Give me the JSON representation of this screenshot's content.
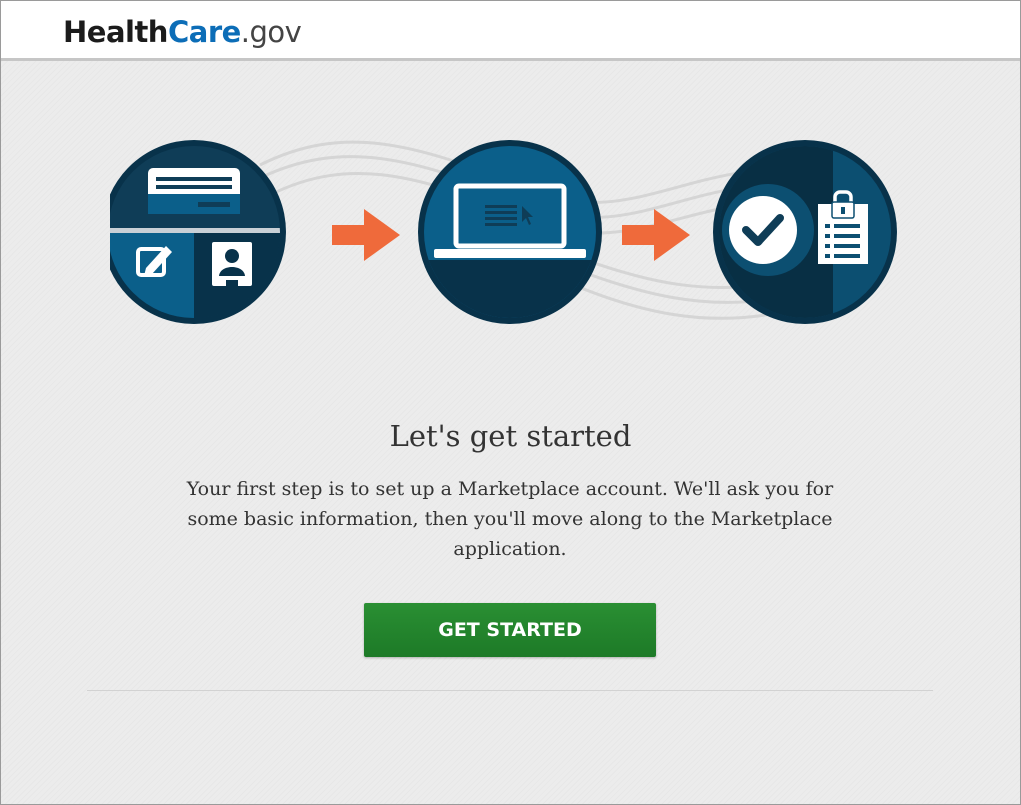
{
  "header": {
    "logo": {
      "part1": "Health",
      "part2": "Care",
      "part3": ".gov"
    }
  },
  "illustration": {
    "steps": [
      {
        "name": "personal-info-step",
        "icons": [
          "id-card-icon",
          "edit-form-icon",
          "user-badge-icon"
        ]
      },
      {
        "name": "online-application-step",
        "icons": [
          "laptop-icon",
          "cursor-icon"
        ]
      },
      {
        "name": "secure-completion-step",
        "icons": [
          "checkmark-icon",
          "locked-clipboard-icon"
        ]
      }
    ],
    "colors": {
      "dark": "#0f3d57",
      "darker": "#08324a",
      "mid": "#0b5f8a",
      "arrow": "#ef6a3b"
    }
  },
  "main": {
    "title": "Let's get started",
    "description": "Your first step is to set up a Marketplace account. We'll ask you for some basic information, then you'll move along to the Marketplace application.",
    "button_label": "GET STARTED",
    "button_color": "#208429"
  }
}
